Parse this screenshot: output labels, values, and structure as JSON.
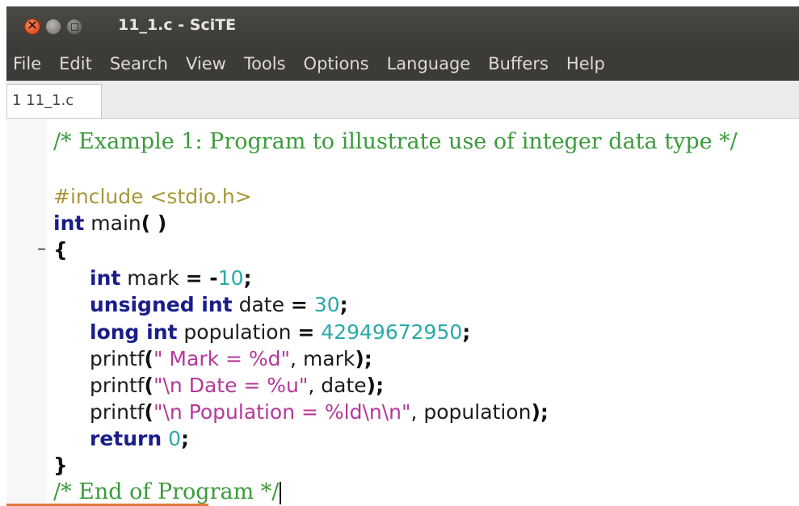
{
  "window": {
    "title": "11_1.c - SciTE"
  },
  "menu": [
    "File",
    "Edit",
    "Search",
    "View",
    "Tools",
    "Options",
    "Language",
    "Buffers",
    "Help"
  ],
  "tab": {
    "label": "1 11_1.c"
  },
  "fold_marker": "–",
  "code": {
    "l1_comment": "/* Example 1: Program to illustrate use of integer data type */",
    "l3_include": "#include <stdio.h>",
    "l4_kw": "int",
    "l4_rest": " main",
    "l4_paren": "( )",
    "l5_brace": "{",
    "l6_kw": "int",
    "l6_ident": " mark ",
    "l6_op": "= -",
    "l6_num": "10",
    "l6_semi": ";",
    "l7_kw": "unsigned int",
    "l7_ident": " date ",
    "l7_op": "=",
    "l7_num": " 30",
    "l7_semi": ";",
    "l8_kw": "long int",
    "l8_ident": " population ",
    "l8_op": "=",
    "l8_num": " 42949672950",
    "l8_semi": ";",
    "l9_fn": "printf",
    "l9_open": "(",
    "l9_str": "\" Mark = %d\"",
    "l9_rest": ", mark",
    "l9_close": ");",
    "l10_fn": "printf",
    "l10_open": "(",
    "l10_str": "\"\\n Date = %u\"",
    "l10_rest": ", date",
    "l10_close": ");",
    "l11_fn": "printf",
    "l11_open": "(",
    "l11_str": "\"\\n Population = %ld\\n\\n\"",
    "l11_rest": ", population",
    "l11_close": ");",
    "l12_kw": "return",
    "l12_num": " 0",
    "l12_semi": ";",
    "l13_brace": "}",
    "l14_comment": "/* End of Program */"
  }
}
